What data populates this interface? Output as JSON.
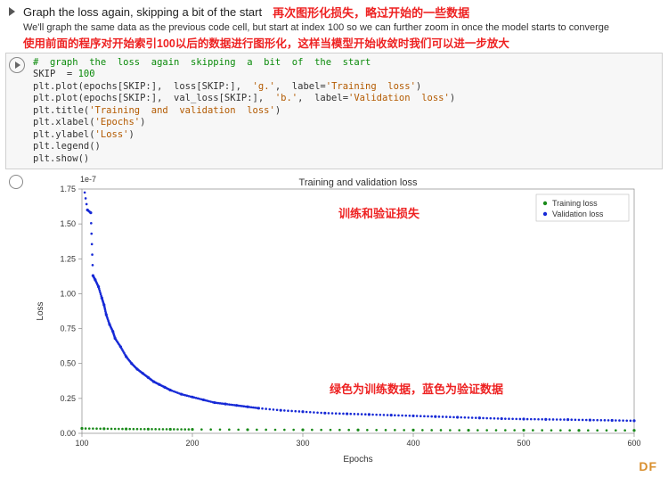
{
  "header": {
    "title": "Graph the loss again, skipping a bit of the start",
    "anno_top": "再次图形化损失，略过开始的一些数据",
    "desc": "We'll graph the same data as the previous code cell, but start at index 100 so we can further zoom in once the model starts to converge",
    "anno_desc": "使用前面的程序对开始索引100以后的数据进行图形化，这样当模型开始收敛时我们可以进一步放大"
  },
  "code": {
    "l1": "#  graph  the  loss  again  skipping  a  bit  of  the  start",
    "l2a": "SKIP  = ",
    "l2b": "100",
    "l3a": "plt.plot(epochs[SKIP:],  loss[SKIP:],  ",
    "l3b": "'g.'",
    "l3c": ",  label=",
    "l3d": "'Training  loss'",
    "l3e": ")",
    "l4a": "plt.plot(epochs[SKIP:],  val_loss[SKIP:],  ",
    "l4b": "'b.'",
    "l4c": ",  label=",
    "l4d": "'Validation  loss'",
    "l4e": ")",
    "l5a": "plt.title(",
    "l5b": "'Training  and  validation  loss'",
    "l5c": ")",
    "l6a": "plt.xlabel(",
    "l6b": "'Epochs'",
    "l6c": ")",
    "l7a": "plt.ylabel(",
    "l7b": "'Loss'",
    "l7c": ")",
    "l8": "plt.legend()",
    "l9": "plt.show()"
  },
  "chart_data": {
    "type": "scatter",
    "title": "Training and validation loss",
    "xlabel": "Epochs",
    "ylabel": "Loss",
    "sci": "1e-7",
    "xlim": [
      100,
      600
    ],
    "ylim": [
      0.0,
      1.75
    ],
    "xticks": [
      100,
      200,
      300,
      400,
      500,
      600
    ],
    "yticks": [
      0.0,
      0.25,
      0.5,
      0.75,
      1.0,
      1.25,
      1.5,
      1.75
    ],
    "series": [
      {
        "name": "Training loss",
        "color": "#1a8a1a",
        "x": [
          100,
          120,
          140,
          160,
          180,
          200,
          250,
          300,
          350,
          400,
          450,
          500,
          550,
          600
        ],
        "y": [
          0.035,
          0.033,
          0.031,
          0.03,
          0.029,
          0.028,
          0.026,
          0.025,
          0.024,
          0.023,
          0.022,
          0.022,
          0.021,
          0.021
        ]
      },
      {
        "name": "Validation loss",
        "color": "#1629d6",
        "x": [
          100,
          105,
          108,
          110,
          112,
          115,
          118,
          120,
          122,
          125,
          128,
          130,
          135,
          140,
          145,
          150,
          155,
          160,
          165,
          170,
          175,
          180,
          190,
          200,
          210,
          220,
          230,
          240,
          250,
          260,
          280,
          300,
          320,
          340,
          360,
          380,
          400,
          420,
          440,
          460,
          480,
          500,
          520,
          540,
          560,
          580,
          600
        ],
        "y": [
          1.85,
          1.6,
          1.58,
          1.13,
          1.1,
          1.05,
          0.97,
          0.92,
          0.85,
          0.78,
          0.73,
          0.68,
          0.62,
          0.55,
          0.5,
          0.46,
          0.43,
          0.4,
          0.37,
          0.35,
          0.33,
          0.31,
          0.28,
          0.26,
          0.24,
          0.22,
          0.21,
          0.2,
          0.19,
          0.18,
          0.165,
          0.155,
          0.145,
          0.14,
          0.135,
          0.13,
          0.125,
          0.12,
          0.115,
          0.11,
          0.105,
          0.102,
          0.1,
          0.098,
          0.095,
          0.093,
          0.09
        ]
      }
    ]
  },
  "anno3": "训练和验证损失",
  "anno4": "绿色为训练数据，蓝色为验证数据",
  "watermark": "DF"
}
